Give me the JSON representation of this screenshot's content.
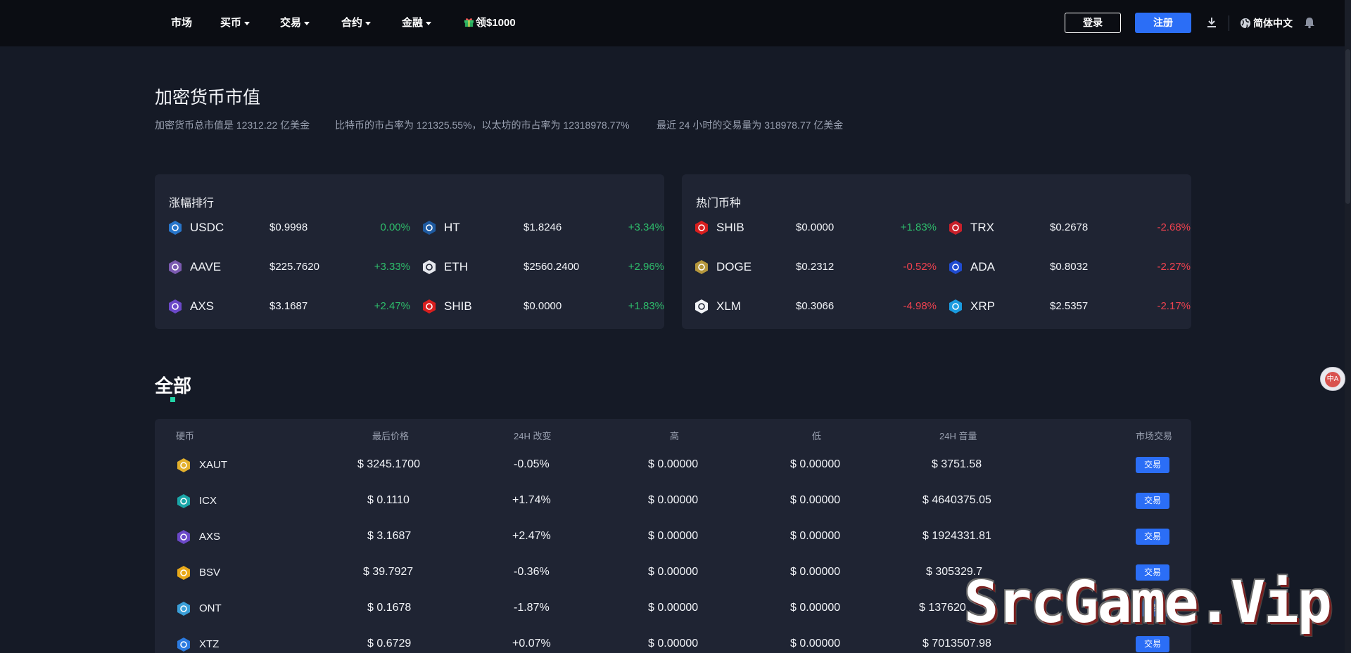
{
  "nav": {
    "items": [
      {
        "label": "市场",
        "caret": false
      },
      {
        "label": "买币",
        "caret": true
      },
      {
        "label": "交易",
        "caret": true
      },
      {
        "label": "合约",
        "caret": true
      },
      {
        "label": "金融",
        "caret": true
      }
    ],
    "promo_label": "领$1000",
    "login_label": "登录",
    "register_label": "注册",
    "language": "简体中文"
  },
  "header": {
    "title": "加密货币市值",
    "summary": [
      "加密货币总市值是 12312.22 亿美金",
      "比特币的市占率为 121325.55%，以太坊的市占率为 12318978.77%",
      "最近 24 小时的交易量为 318978.77 亿美金"
    ]
  },
  "cards": [
    {
      "title": "涨幅排行",
      "items": [
        {
          "symbol": "USDC",
          "price": "$0.9998",
          "change": "0.00%",
          "trend": "up",
          "icon": "usdc-icon",
          "color": "#2775ca"
        },
        {
          "symbol": "HT",
          "price": "$1.8246",
          "change": "+3.34%",
          "trend": "up",
          "icon": "ht-icon",
          "color": "#1e5aa0"
        },
        {
          "symbol": "AAVE",
          "price": "$225.7620",
          "change": "+3.33%",
          "trend": "up",
          "icon": "aave-icon",
          "color": "#7b5ab0"
        },
        {
          "symbol": "ETH",
          "price": "$2560.2400",
          "change": "+2.96%",
          "trend": "up",
          "icon": "eth-icon",
          "color": "#e6e8ee"
        },
        {
          "symbol": "AXS",
          "price": "$3.1687",
          "change": "+2.47%",
          "trend": "up",
          "icon": "axs-icon",
          "color": "#6b48c8"
        },
        {
          "symbol": "SHIB",
          "price": "$0.0000",
          "change": "+1.83%",
          "trend": "up",
          "icon": "shib-icon",
          "color": "#d81e1e"
        }
      ]
    },
    {
      "title": "热门币种",
      "items": [
        {
          "symbol": "SHIB",
          "price": "$0.0000",
          "change": "+1.83%",
          "trend": "up",
          "icon": "shib-icon",
          "color": "#d81e1e"
        },
        {
          "symbol": "TRX",
          "price": "$0.2678",
          "change": "-2.68%",
          "trend": "down",
          "icon": "trx-icon",
          "color": "#c8202a"
        },
        {
          "symbol": "DOGE",
          "price": "$0.2312",
          "change": "-0.52%",
          "trend": "down",
          "icon": "doge-icon",
          "color": "#b5973c"
        },
        {
          "symbol": "ADA",
          "price": "$0.8032",
          "change": "-2.27%",
          "trend": "down",
          "icon": "ada-icon",
          "color": "#1f4bd0"
        },
        {
          "symbol": "XLM",
          "price": "$0.3066",
          "change": "-4.98%",
          "trend": "down",
          "icon": "xlm-icon",
          "color": "#f2f4f8"
        },
        {
          "symbol": "XRP",
          "price": "$2.5357",
          "change": "-2.17%",
          "trend": "down",
          "icon": "xrp-icon",
          "color": "#1a9be0"
        }
      ]
    }
  ],
  "section": {
    "title": "全部"
  },
  "table": {
    "headers": [
      "硬币",
      "最后价格",
      "24H 改变",
      "高",
      "低",
      "24H 音量",
      "市场交易"
    ],
    "trade_label": "交易",
    "rows": [
      {
        "symbol": "XAUT",
        "price": "$ 3245.1700",
        "change": "-0.05%",
        "trend": "down",
        "high": "$ 0.00000",
        "low": "$ 0.00000",
        "volume": "$ 3751.58",
        "icon": "xaut-icon",
        "color": "#e3b02c"
      },
      {
        "symbol": "ICX",
        "price": "$ 0.1110",
        "change": "+1.74%",
        "trend": "up",
        "high": "$ 0.00000",
        "low": "$ 0.00000",
        "volume": "$ 4640375.05",
        "icon": "icx-icon",
        "color": "#1aa6a8"
      },
      {
        "symbol": "AXS",
        "price": "$ 3.1687",
        "change": "+2.47%",
        "trend": "up",
        "high": "$ 0.00000",
        "low": "$ 0.00000",
        "volume": "$ 1924331.81",
        "icon": "axs-icon",
        "color": "#6b48c8"
      },
      {
        "symbol": "BSV",
        "price": "$ 39.7927",
        "change": "-0.36%",
        "trend": "down",
        "high": "$ 0.00000",
        "low": "$ 0.00000",
        "volume": "$ 305329.7",
        "icon": "bsv-icon",
        "color": "#e8a91a"
      },
      {
        "symbol": "ONT",
        "price": "$ 0.1678",
        "change": "-1.87%",
        "trend": "down",
        "high": "$ 0.00000",
        "low": "$ 0.00000",
        "volume": "$ 137620",
        "icon": "ont-icon",
        "color": "#3a9fd8"
      },
      {
        "symbol": "XTZ",
        "price": "$ 0.6729",
        "change": "+0.07%",
        "trend": "up",
        "high": "$ 0.00000",
        "low": "$ 0.00000",
        "volume": "$ 7013507.98",
        "icon": "xtz-icon",
        "color": "#2c7be0"
      }
    ]
  },
  "translate_label": "中A",
  "watermark": "SrcGame.Vip",
  "colors": {
    "up": "#2ebd6b",
    "down": "#f0424f",
    "accent": "#2b6ef6",
    "background": "#151a26",
    "card": "#1f2433"
  }
}
